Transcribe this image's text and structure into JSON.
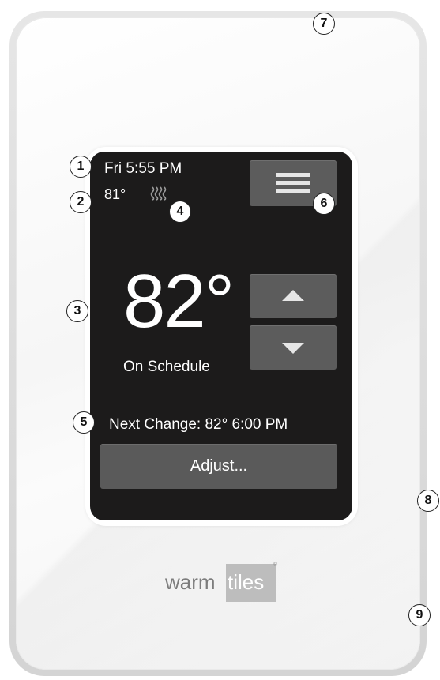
{
  "device": {
    "brand": "warmtiles",
    "brand_parts": [
      "warm",
      "tiles"
    ]
  },
  "screen": {
    "day_time": "Fri 5:55 PM",
    "floor_temp": "81°",
    "set_temp": "82°",
    "status": "On Schedule",
    "next_change": "Next Change: 82°  6:00 PM",
    "adjust_label": "Adjust...",
    "heating_icon": "heat-waves-icon",
    "menu_icon": "hamburger-menu-icon",
    "up_icon": "triangle-up-icon",
    "down_icon": "triangle-down-icon"
  },
  "callouts": [
    "1",
    "2",
    "3",
    "4",
    "5",
    "6",
    "7",
    "8",
    "9"
  ],
  "colors": {
    "screen_bg": "#1c1b1b",
    "button_bg": "#5c5c5c",
    "text": "#ffffff",
    "bezel": "#d9d9d9"
  }
}
